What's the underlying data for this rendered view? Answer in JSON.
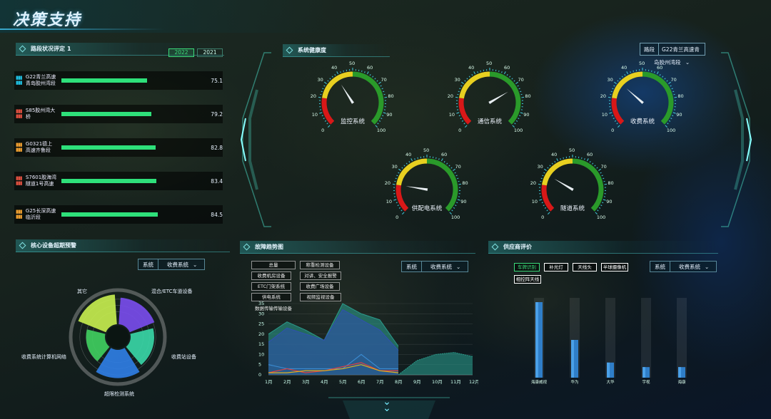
{
  "title": "决策支持",
  "road": {
    "title": "路段状况评定",
    "subtitle": "1",
    "years": [
      "2022",
      "2021"
    ],
    "rows": [
      {
        "name": "G22青兰高速青岛胶州湾段",
        "value": "75.1",
        "pct": 0.751,
        "color": "#1fbfe0"
      },
      {
        "name": "S85胶州湾大桥",
        "value": "79.2",
        "pct": 0.792,
        "color": "#e05040"
      },
      {
        "name": "G0321德上高速齐鲁段",
        "value": "82.8",
        "pct": 0.828,
        "color": "#f0a030"
      },
      {
        "name": "S7601胶海湾隧道1号高速",
        "value": "83.4",
        "pct": 0.834,
        "color": "#e05040"
      },
      {
        "name": "G25长深高速临沂段",
        "value": "84.5",
        "pct": 0.845,
        "color": "#f0a030"
      }
    ]
  },
  "health": {
    "title": "系统健康度",
    "road_label": "路段",
    "road_value": "G22青兰高速青",
    "section_value": "岛胶州湾段",
    "gauges": [
      {
        "name": "监控系统",
        "value": 38
      },
      {
        "name": "通信系统",
        "value": 72
      },
      {
        "name": "收费系统",
        "value": 32
      },
      {
        "name": "供配电系统",
        "value": 20
      },
      {
        "name": "隧道系统",
        "value": 28
      }
    ],
    "ticks": [
      "0",
      "10",
      "20",
      "30",
      "40",
      "50",
      "60",
      "70",
      "80",
      "90",
      "100"
    ]
  },
  "core": {
    "title": "核心设备超期预警",
    "sel_label": "系统",
    "sel_value": "收费系统",
    "labels": [
      "其它",
      "混合/ETC车道设备",
      "收费站设备",
      "超限检测系统",
      "收费系统计算机网络"
    ],
    "slices": [
      0.85,
      0.75,
      0.9,
      0.6,
      0.95
    ]
  },
  "fault": {
    "title": "故障趋势图",
    "sel_label": "系统",
    "sel_value": "收费系统",
    "legend": [
      "总量",
      "称重检测设备",
      "收费机房设备",
      "对讲、安全报警",
      "ETC门架系统",
      "收费广场设备",
      "供电系统",
      "视频监视设备",
      "数据传输传输设备"
    ],
    "yticks": [
      "0",
      "5",
      "10",
      "15",
      "20",
      "25",
      "30",
      "35"
    ],
    "months": [
      "1月",
      "2月",
      "3月",
      "4月",
      "5月",
      "6月",
      "7月",
      "8月",
      "9月",
      "10月",
      "11月",
      "12月"
    ]
  },
  "chart_data": {
    "type": "area",
    "x": [
      "1月",
      "2月",
      "3月",
      "4月",
      "5月",
      "6月",
      "7月",
      "8月",
      "9月",
      "10月",
      "11月",
      "12月"
    ],
    "ylim": [
      0,
      35
    ],
    "series": [
      {
        "values": [
          20,
          26,
          22,
          17,
          35,
          30,
          27,
          14,
          null,
          null,
          null,
          null
        ],
        "color": "#2a9a8a"
      },
      {
        "values": [
          16,
          23,
          20,
          17,
          32,
          27,
          22,
          12,
          null,
          null,
          null,
          null
        ],
        "color": "#3050b0"
      },
      {
        "values": [
          null,
          null,
          null,
          null,
          null,
          null,
          null,
          0,
          7,
          10,
          11,
          9
        ],
        "color": "#2a9a8a"
      },
      {
        "values": [
          5,
          3,
          3,
          3,
          3,
          10,
          3,
          3,
          null,
          null,
          null,
          null
        ],
        "color": "#3a8ad0"
      },
      {
        "values": [
          1,
          3,
          1,
          2,
          4,
          6,
          2,
          2,
          null,
          null,
          null,
          null
        ],
        "color": "#e04040"
      },
      {
        "values": [
          1,
          1,
          2,
          2,
          3,
          5,
          2,
          1,
          null,
          null,
          null,
          null
        ],
        "color": "#e0b020"
      }
    ]
  },
  "supplier": {
    "title": "供应商评价",
    "sel_label": "系统",
    "sel_value": "收费系统",
    "tags": [
      "车牌识别",
      "补光灯",
      "天线头",
      "半球摄像机",
      "相控阵天线"
    ],
    "bars": [
      {
        "name": "海康威视",
        "value": 1.0
      },
      {
        "name": "华为",
        "value": 0.5
      },
      {
        "name": "大华",
        "value": 0.2
      },
      {
        "name": "宇视",
        "value": 0.14
      },
      {
        "name": "海康",
        "value": 0.14
      }
    ]
  }
}
